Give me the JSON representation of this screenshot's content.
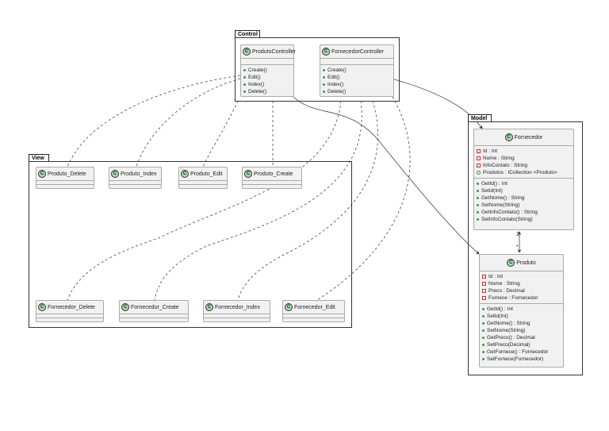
{
  "packages": {
    "control": "Control",
    "model": "Model",
    "view": "View"
  },
  "class_icon": "C",
  "controllers": [
    {
      "name": "ProdutoController",
      "methods": [
        "Create()",
        "Edit()",
        "Index()",
        "Delete()"
      ]
    },
    {
      "name": "FornecedorController",
      "methods": [
        "Create()",
        "Edit()",
        "Index()",
        "Delete()"
      ]
    }
  ],
  "model": {
    "fornecedor": {
      "name": "Fornecedor",
      "attributes": [
        {
          "vis": "private",
          "text": "Id : Int"
        },
        {
          "vis": "private",
          "text": "Nome : String"
        },
        {
          "vis": "private",
          "text": "InfoContato : String"
        },
        {
          "vis": "public",
          "text": "Produtos : ICollection <Produto>"
        }
      ],
      "methods": [
        "GetId() : Int",
        "SetId(Int)",
        "GetNome() : String",
        "SetNome(String)",
        "GetInfoContato() : String",
        "SetInfoContato(String)"
      ]
    },
    "produto": {
      "name": "Produto",
      "attributes": [
        {
          "vis": "private",
          "text": "Id : Int"
        },
        {
          "vis": "private",
          "text": "Nome : String"
        },
        {
          "vis": "private",
          "text": "Preco : Decimal"
        },
        {
          "vis": "private",
          "text": "Fornece : Fornecedor"
        }
      ],
      "methods": [
        "GetId() : Int",
        "SetId(Int)",
        "GetNome() : String",
        "SetNome(String)",
        "GetPreco() : Decimal",
        "SetPreco(Decimal)",
        "GetFornece() : Fornecedor",
        "SetFornece(Fornecedor)"
      ]
    },
    "multiplicity": {
      "fornecedor_end": "1",
      "produto_end": "*"
    }
  },
  "views": [
    "Produto_Delete",
    "Produto_Index",
    "Produto_Edit",
    "Produto_Create",
    "Fornecedor_Delete",
    "Fornecedor_Create",
    "Fornecedor_Index",
    "Fornecedor_Edit"
  ]
}
